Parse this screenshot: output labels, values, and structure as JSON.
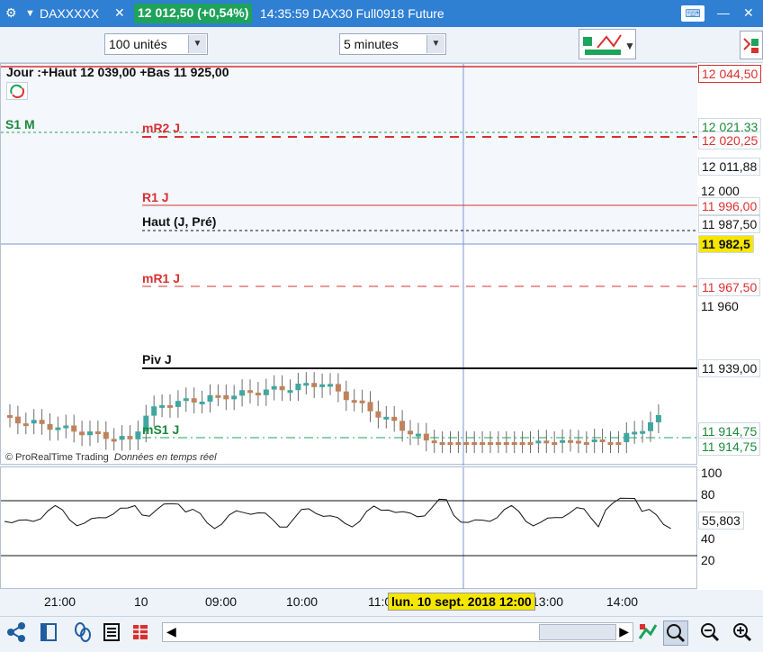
{
  "titlebar": {
    "instrument": "DAXXXXX",
    "price_badge": "12 012,50 (+0,54%)",
    "info": "14:35:59 DAX30 Full0918 Future"
  },
  "toolbar": {
    "units": "100 unités",
    "timeframe": "5 minutes"
  },
  "chart": {
    "header": "Jour :+Haut 12 039,00 +Bas 11 925,00",
    "credit": "© ProRealTime Trading",
    "credit_realtime": "Données en temps réel",
    "crosshair_date": "lun. 10 sept. 2018 12:00",
    "levels": {
      "s1m": "S1 M",
      "mr2": "mR2 J",
      "r1": "R1 J",
      "haut": "Haut (J, Pré)",
      "mr1": "mR1 J",
      "piv": "Piv J",
      "ms1": "mS1 J"
    },
    "price_labels": {
      "l1": "12 044,50",
      "l2": "12 021,33",
      "l3": "12 020,25",
      "l4": "12 011,88",
      "l5": "12 000",
      "l6": "11 996,00",
      "l7": "11 987,50",
      "l8": "11 982,5",
      "l9": "11 967,50",
      "l10": "11 960",
      "l11": "11 939,00",
      "l12": "11 914,75",
      "l13": "11 914,75"
    },
    "x_labels": [
      "21:00",
      "10",
      "09:00",
      "10:00",
      "11:00",
      "13:00",
      "14:00"
    ],
    "osc_axis": [
      "100",
      "80",
      "40",
      "20"
    ],
    "osc_value": "55,803"
  }
}
